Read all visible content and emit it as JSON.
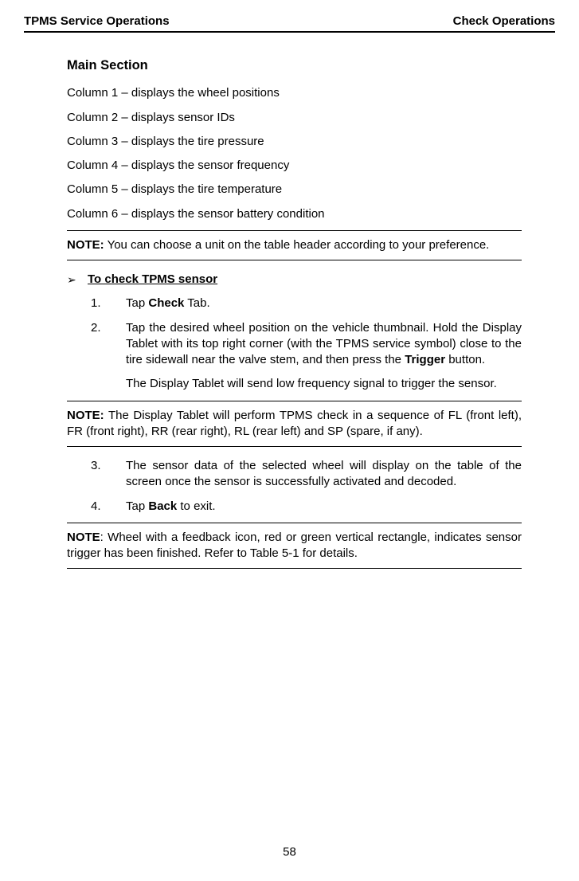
{
  "header": {
    "left": "TPMS Service Operations",
    "right": "Check Operations"
  },
  "mainSection": {
    "title": "Main Section",
    "columns": [
      "Column 1 – displays the wheel positions",
      "Column 2 – displays sensor IDs",
      "Column 3 – displays the tire pressure",
      "Column 4 – displays the sensor frequency",
      "Column 5 – displays the tire temperature",
      "Column 6 – displays the sensor battery condition"
    ]
  },
  "note1": {
    "label": "NOTE:",
    "text": " You can choose a unit on the table header according to your preference."
  },
  "procedure": {
    "marker": "➢",
    "title": "To check TPMS sensor"
  },
  "steps12": [
    {
      "num": "1.",
      "pre": "Tap ",
      "bold": "Check",
      "post": " Tab."
    },
    {
      "num": "2.",
      "pre": "Tap the desired wheel position on the vehicle thumbnail. Hold the Display Tablet with its top right corner (with the TPMS service symbol) close to the tire sidewall near the valve stem, and then press the ",
      "bold": "Trigger",
      "post": " button.",
      "sub": "The Display Tablet will send low frequency signal to trigger the sensor."
    }
  ],
  "note2": {
    "label": "NOTE:",
    "text": " The Display Tablet will perform TPMS check in a sequence of FL (front left), FR (front right), RR (rear right), RL (rear left) and SP (spare, if any)."
  },
  "steps34": [
    {
      "num": "3.",
      "pre": "The sensor data of the selected wheel will display on the table of the screen once the sensor is successfully activated and decoded.",
      "bold": "",
      "post": ""
    },
    {
      "num": "4.",
      "pre": "Tap ",
      "bold": "Back",
      "post": " to exit."
    }
  ],
  "note3": {
    "label": "NOTE",
    "text": ": Wheel with a feedback icon, red or green vertical rectangle, indicates sensor trigger has been finished. Refer to Table 5-1 for details."
  },
  "pageNumber": "58"
}
